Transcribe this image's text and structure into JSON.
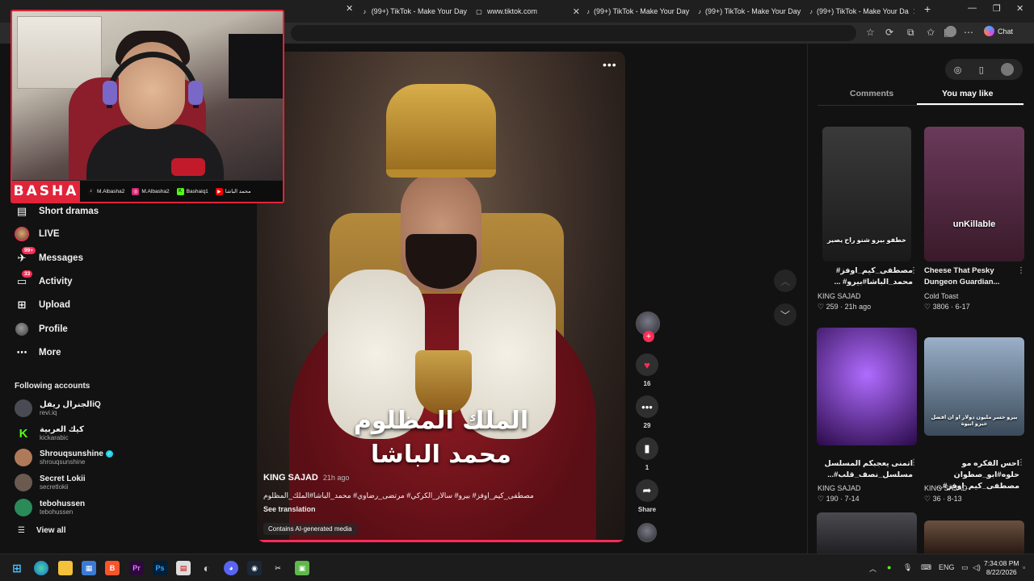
{
  "browser": {
    "tabs": [
      {
        "label": "(99+) TikTok - Make Your Day",
        "icon": "tiktok-icon"
      },
      {
        "label": "www.tiktok.com",
        "icon": "page-icon"
      },
      {
        "label": "(99+) TikTok - Make Your Day",
        "icon": "tiktok-icon"
      },
      {
        "label": "(99+) TikTok - Make Your Day",
        "icon": "tiktok-icon"
      },
      {
        "label": "(99+) TikTok - Make Your Da",
        "icon": "tiktok-icon"
      }
    ],
    "chat_label": "Chat"
  },
  "sidebar": {
    "items": [
      {
        "label": "Short dramas",
        "icon": "short-dramas-icon"
      },
      {
        "label": "LIVE",
        "icon": "live-avatar"
      },
      {
        "label": "Messages",
        "icon": "messages-icon",
        "badge": "99+"
      },
      {
        "label": "Activity",
        "icon": "activity-icon",
        "badge": "33"
      },
      {
        "label": "Upload",
        "icon": "upload-icon"
      },
      {
        "label": "Profile",
        "icon": "profile-avatar"
      },
      {
        "label": "More",
        "icon": "more-icon"
      }
    ],
    "following_title": "Following accounts",
    "accounts": [
      {
        "name": "الجنرال ريفلiQ",
        "handle": "revi.iq",
        "color": "#4a4a52"
      },
      {
        "name": "كيك العربية",
        "handle": "kickarabic",
        "color": "#53fc18"
      },
      {
        "name": "Shrouqsunshine",
        "handle": "shrouqsunshine",
        "color": "#b07a5a",
        "verified": true
      },
      {
        "name": "Secret Lokii",
        "handle": "secretlokii",
        "color": "#6a5a50"
      },
      {
        "name": "tebohussen",
        "handle": "tebohussen",
        "color": "#2a8a5a"
      }
    ],
    "view_all": "View all"
  },
  "webcam": {
    "brand": "BASHA",
    "socials": [
      {
        "label": "M.Albasha2",
        "icon": "tiktok-icon",
        "color": "#111111"
      },
      {
        "label": "M.Albasha2",
        "icon": "instagram-icon",
        "color": "#d62976"
      },
      {
        "label": "Bashaiq1",
        "icon": "kick-icon",
        "color": "#53fc18"
      },
      {
        "label": "محمد الباشا",
        "icon": "youtube-icon",
        "color": "#ff0000"
      }
    ]
  },
  "video": {
    "caption_line1": "الملك المظلوم",
    "caption_line2": "محمد الباشا",
    "author": "KING SAJAD",
    "posted": "21h ago",
    "description": "مصطفى_كيم_اوفز# بيرو# سالار_الكركي# مرتضى_رضاوي# محمد_الباشا#الملك_المظلوم",
    "see_translation": "See translation",
    "ai_label": "Contains AI-generated media",
    "progress": 1.0
  },
  "actions": {
    "likes": "16",
    "comments": "29",
    "saves": "1",
    "share_label": "Share"
  },
  "right_panel": {
    "tabs": [
      {
        "label": "Comments",
        "active": false
      },
      {
        "label": "You may like",
        "active": true
      }
    ],
    "cards": [
      {
        "title": "مصطفى_كيم_اوفز# محمد_الباشا#بيرو# ...",
        "author": "KING SAJAD",
        "likes": "259",
        "date": "21h ago",
        "overlay": "خطفو بيرو شنو راح يصير",
        "bg": "linear-gradient(#3a3a3a,#1a1a1a)"
      },
      {
        "title": "Cheese That Pesky Dungeon Guardian...",
        "author": "Cold Toast",
        "likes": "3806",
        "date": "6-17",
        "overlay": "unKillable",
        "bg": "linear-gradient(#6a3a5a,#3a1a2a)"
      },
      {
        "title": "اتمنى يعجبكم المسلسل مسلسل_نصف_قلب#...",
        "author": "KING SAJAD",
        "likes": "190",
        "date": "7-14",
        "overlay": "",
        "bg": "radial-gradient(circle at 50% 40%,#b06cff,#2a0a4a)"
      },
      {
        "title": "احس الفكره مو حلوه#ابو_صطوان مصطفى_كيم_اوفز#...",
        "author": "KING SAJAD",
        "likes": "36",
        "date": "8-13",
        "overlay": "بيرو خسر مليون دولار او ان افضل خبزو ابيوة",
        "bg": "linear-gradient(#9ab0c8,#3a4a5a)"
      }
    ]
  },
  "taskbar": {
    "language": "ENG",
    "time": "7:34:08 PM",
    "date": "8/22/2026"
  }
}
